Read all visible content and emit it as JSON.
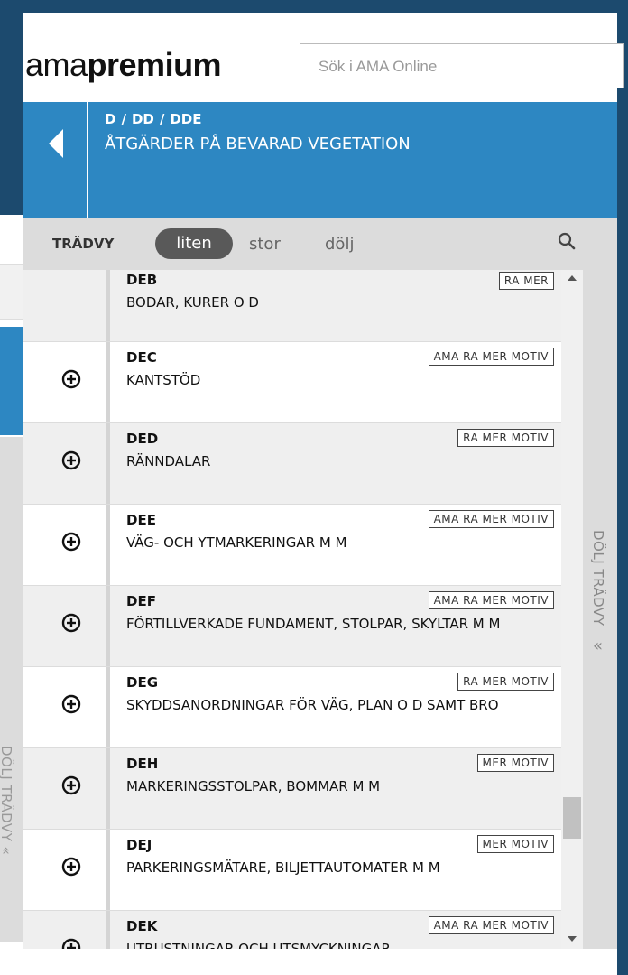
{
  "background": {
    "side_label": "DÖLJ TRÄDVY «"
  },
  "header": {
    "logo_light": "ama",
    "logo_bold": "premium",
    "search_placeholder": "Sök i AMA Online"
  },
  "breadcrumb": {
    "items": [
      "D",
      "DD",
      "DDE"
    ],
    "separator": "/",
    "title": "ÅTGÄRDER PÅ BEVARAD VEGETATION"
  },
  "tree": {
    "label": "TRÄDVY",
    "options": [
      "liten",
      "stor",
      "dölj"
    ],
    "selected": "liten"
  },
  "rows": [
    {
      "code": "DEB",
      "desc": "BODAR, KURER O D",
      "tags": "RA MER",
      "expandable": false
    },
    {
      "code": "DEC",
      "desc": "KANTSTÖD",
      "tags": "AMA RA MER MOTIV",
      "expandable": true
    },
    {
      "code": "DED",
      "desc": "RÄNNDALAR",
      "tags": "RA MER MOTIV",
      "expandable": true
    },
    {
      "code": "DEE",
      "desc": "VÄG- OCH YTMARKERINGAR M M",
      "tags": "AMA RA MER MOTIV",
      "expandable": true
    },
    {
      "code": "DEF",
      "desc": "FÖRTILLVERKADE FUNDAMENT, STOLPAR, SKYLTAR M M",
      "tags": "AMA RA MER MOTIV",
      "expandable": true
    },
    {
      "code": "DEG",
      "desc": "SKYDDSANORDNINGAR FÖR VÄG, PLAN O D SAMT BRO",
      "tags": "RA MER MOTIV",
      "expandable": true
    },
    {
      "code": "DEH",
      "desc": "MARKERINGSSTOLPAR, BOMMAR M M",
      "tags": "MER MOTIV",
      "expandable": true
    },
    {
      "code": "DEJ",
      "desc": "PARKERINGSMÄTARE, BILJETTAUTOMATER M M",
      "tags": "MER MOTIV",
      "expandable": true
    },
    {
      "code": "DEK",
      "desc": "UTRUSTNINGAR OCH UTSMYCKNINGAR",
      "tags": "AMA RA MER MOTIV",
      "expandable": true
    }
  ],
  "sidebar": {
    "label": "DÖLJ TRÄDVY",
    "chevron": "«"
  },
  "colors": {
    "brand_blue": "#2d87c2",
    "dark_bg": "#1c4a6e"
  }
}
